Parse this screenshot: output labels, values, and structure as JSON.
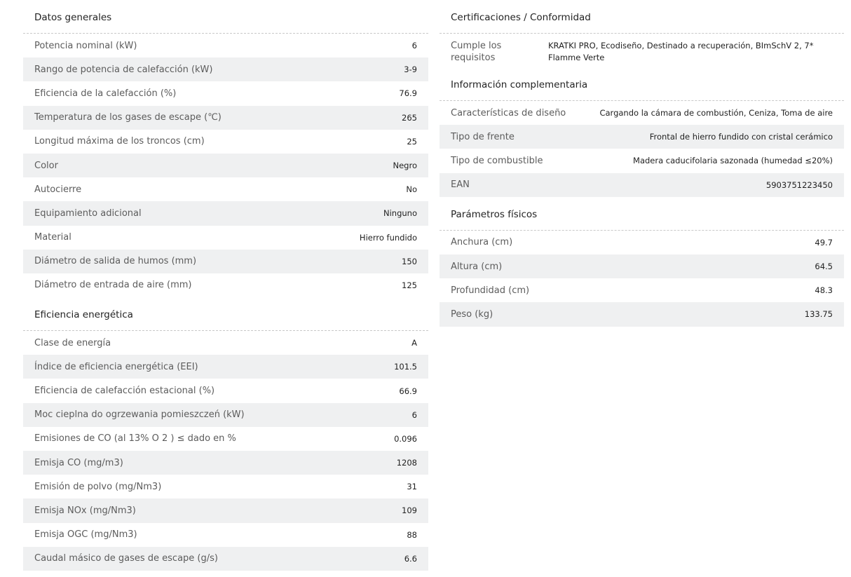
{
  "left": {
    "general": {
      "title": "Datos generales",
      "rows": [
        {
          "label": "Potencia nominal (kW)",
          "value": "6"
        },
        {
          "label": "Rango de potencia de calefacción (kW)",
          "value": "3-9"
        },
        {
          "label": "Eficiencia de la calefacción (%)",
          "value": "76.9"
        },
        {
          "label": "Temperatura de los gases de escape (℃)",
          "value": "265"
        },
        {
          "label": "Longitud máxima de los troncos (cm)",
          "value": "25"
        },
        {
          "label": "Color",
          "value": "Negro"
        },
        {
          "label": "Autocierre",
          "value": "No"
        },
        {
          "label": "Equipamiento adicional",
          "value": "Ninguno"
        },
        {
          "label": "Material",
          "value": "Hierro fundido"
        },
        {
          "label": "Diámetro de salida de humos (mm)",
          "value": "150"
        },
        {
          "label": "Diámetro de entrada de aire (mm)",
          "value": "125"
        }
      ]
    },
    "energy": {
      "title": "Eficiencia energética",
      "rows": [
        {
          "label": "Clase de energía",
          "value": "A"
        },
        {
          "label": "Índice de eficiencia energética (EEI)",
          "value": "101.5"
        },
        {
          "label": "Eficiencia de calefacción estacional (%)",
          "value": "66.9"
        },
        {
          "label": "Moc cieplna do ogrzewania pomieszczeń (kW)",
          "value": "6"
        },
        {
          "label": "Emisiones de CO (al 13% O 2 ) ≤ dado en %",
          "value": "0.096"
        },
        {
          "label": "Emisja CO (mg/m3)",
          "value": "1208"
        },
        {
          "label": "Emisión de polvo (mg/Nm3)",
          "value": "31"
        },
        {
          "label": "Emisja NOx (mg/Nm3)",
          "value": "109"
        },
        {
          "label": "Emisja OGC (mg/Nm3)",
          "value": "88"
        },
        {
          "label": "Caudal másico de gases de escape (g/s)",
          "value": "6.6"
        }
      ]
    }
  },
  "right": {
    "certifications": {
      "title": "Certificaciones / Conformidad",
      "rows": [
        {
          "label": "Cumple los requisitos",
          "value": "KRATKI PRO, Ecodiseño, Destinado a recuperación, BImSchV 2, 7* Flamme Verte"
        }
      ]
    },
    "complementary": {
      "title": "Información complementaria",
      "rows": [
        {
          "label": "Características de diseño",
          "value": "Cargando la cámara de combustión, Ceniza, Toma de aire"
        },
        {
          "label": "Tipo de frente",
          "value": "Frontal de hierro fundido con cristal cerámico"
        },
        {
          "label": "Tipo de combustible",
          "value": "Madera caducifolaria sazonada (humedad ≤20%)"
        },
        {
          "label": "EAN",
          "value": "5903751223450"
        }
      ]
    },
    "physical": {
      "title": "Parámetros físicos",
      "rows": [
        {
          "label": "Anchura (cm)",
          "value": "49.7"
        },
        {
          "label": "Altura (cm)",
          "value": "64.5"
        },
        {
          "label": "Profundidad (cm)",
          "value": "48.3"
        },
        {
          "label": "Peso (kg)",
          "value": "133.75"
        }
      ]
    }
  }
}
